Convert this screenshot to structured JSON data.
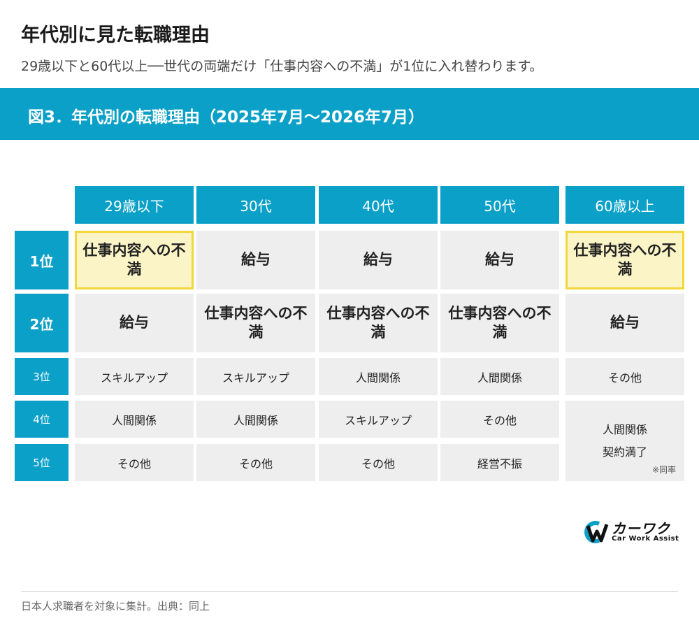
{
  "title": "年代別に見た転職理由",
  "subtitle": "29歳以下と60代以上──世代の両端だけ「仕事内容への不満」が1位に入れ替わります。",
  "banner": "図3．年代別の転職理由（2025年7月〜2026年7月）",
  "chart_data": {
    "type": "table",
    "title": "図3．年代別の転職理由（2025年7月〜2026年7月）",
    "columns": [
      "29歳以下",
      "30代",
      "40代",
      "50代",
      "60歳以上"
    ],
    "rows": [
      "1位",
      "2位",
      "3位",
      "4位",
      "5位"
    ],
    "cells": [
      [
        "仕事内容への不満",
        "給与",
        "給与",
        "給与",
        "仕事内容への不満"
      ],
      [
        "給与",
        "仕事内容への不満",
        "仕事内容への不満",
        "仕事内容への不満",
        "給与"
      ],
      [
        "スキルアップ",
        "スキルアップ",
        "人間関係",
        "人間関係",
        "その他"
      ],
      [
        "人間関係",
        "人間関係",
        "スキルアップ",
        "その他",
        "人間関係"
      ],
      [
        "その他",
        "その他",
        "その他",
        "経営不振",
        "契約満了"
      ]
    ],
    "merged_note": "※同率",
    "highlighted": [
      [
        0,
        0
      ],
      [
        0,
        4
      ]
    ],
    "colors": {
      "header": "#0aa0c8",
      "cell": "#eeeeee",
      "highlight": "#fbf4c6",
      "highlight_border": "#f2d73a"
    }
  },
  "logo": {
    "jp": "カーワク",
    "en": "Car Work Assist",
    "icon": "cw-logo-icon"
  },
  "footer": "日本人求職者を対象に集計。出典：同上"
}
